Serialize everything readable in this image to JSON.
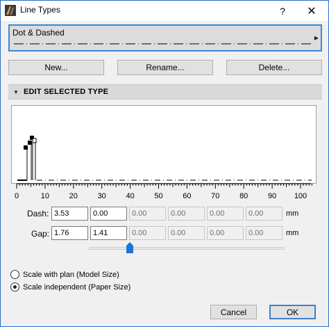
{
  "window": {
    "title": "Line Types",
    "help_label": "?",
    "close_label": "✕",
    "border_color": "#2b6cc4"
  },
  "line_type_selector": {
    "selected": "Dot & Dashed",
    "arrow": "▶"
  },
  "actions": {
    "new_label": "New...",
    "rename_label": "Rename...",
    "delete_label": "Delete..."
  },
  "section": {
    "title": "EDIT SELECTED TYPE",
    "collapse_arrow": "▼"
  },
  "ruler": {
    "labels": [
      "0",
      "10",
      "20",
      "30",
      "40",
      "50",
      "60",
      "70",
      "80",
      "90",
      "100"
    ]
  },
  "dash_row": {
    "label": "Dash:",
    "values": [
      "3.53",
      "0.00",
      "0.00",
      "0.00",
      "0.00",
      "0.00"
    ],
    "unit": "mm"
  },
  "gap_row": {
    "label": "Gap:",
    "values": [
      "1.76",
      "1.41",
      "0.00",
      "0.00",
      "0.00",
      "0.00"
    ],
    "unit": "mm"
  },
  "slider": {
    "position_fraction": 0.2,
    "thumb_color": "#1e74d8"
  },
  "scale_options": {
    "options": [
      {
        "label": "Scale with plan (Model Size)",
        "selected": false
      },
      {
        "label": "Scale independent (Paper Size)",
        "selected": true
      }
    ]
  },
  "footer": {
    "cancel_label": "Cancel",
    "ok_label": "OK"
  }
}
